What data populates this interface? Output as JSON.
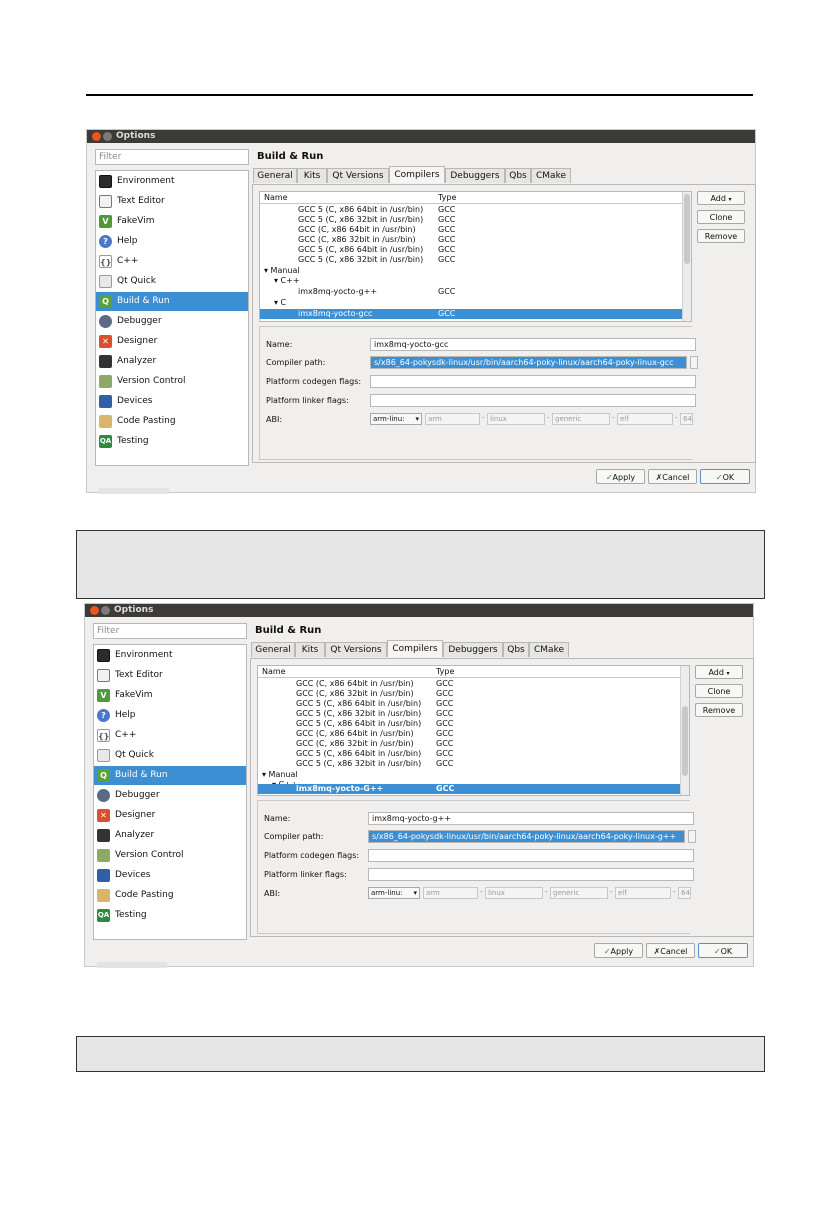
{
  "windows": [
    {
      "title": "Options",
      "filter_placeholder": "Filter",
      "heading": "Build & Run",
      "sidebar": [
        {
          "label": "Environment",
          "icon": "environment-icon"
        },
        {
          "label": "Text Editor",
          "icon": "text-editor-icon"
        },
        {
          "label": "FakeVim",
          "icon": "fakevim-icon"
        },
        {
          "label": "Help",
          "icon": "help-icon"
        },
        {
          "label": "C++",
          "icon": "cpp-icon"
        },
        {
          "label": "Qt Quick",
          "icon": "qt-quick-icon"
        },
        {
          "label": "Build & Run",
          "icon": "build-run-icon",
          "selected": true
        },
        {
          "label": "Debugger",
          "icon": "debugger-icon"
        },
        {
          "label": "Designer",
          "icon": "designer-icon"
        },
        {
          "label": "Analyzer",
          "icon": "analyzer-icon"
        },
        {
          "label": "Version Control",
          "icon": "version-control-icon"
        },
        {
          "label": "Devices",
          "icon": "devices-icon"
        },
        {
          "label": "Code Pasting",
          "icon": "code-pasting-icon"
        },
        {
          "label": "Testing",
          "icon": "testing-icon"
        }
      ],
      "tabs": [
        "General",
        "Kits",
        "Qt Versions",
        "Compilers",
        "Debuggers",
        "Qbs",
        "CMake"
      ],
      "active_tab": "Compilers",
      "table_headers": {
        "name": "Name",
        "type": "Type"
      },
      "rows": [
        {
          "name": "GCC 5 (C, x86 64bit in /usr/bin)",
          "type": "GCC",
          "indent": 3
        },
        {
          "name": "GCC 5 (C, x86 32bit in /usr/bin)",
          "type": "GCC",
          "indent": 3
        },
        {
          "name": "GCC (C, x86 64bit in /usr/bin)",
          "type": "GCC",
          "indent": 3
        },
        {
          "name": "GCC (C, x86 32bit in /usr/bin)",
          "type": "GCC",
          "indent": 3
        },
        {
          "name": "GCC 5 (C, x86 64bit in /usr/bin)",
          "type": "GCC",
          "indent": 3
        },
        {
          "name": "GCC 5 (C, x86 32bit in /usr/bin)",
          "type": "GCC",
          "indent": 3
        },
        {
          "name": "▾ Manual",
          "type": "",
          "indent": 0
        },
        {
          "name": "▾ C++",
          "type": "",
          "indent": 1
        },
        {
          "name": "imx8mq-yocto-g++",
          "type": "GCC",
          "indent": 3
        },
        {
          "name": "▾ C",
          "type": "",
          "indent": 1
        },
        {
          "name": "imx8mq-yocto-gcc",
          "type": "GCC",
          "indent": 3,
          "selected": true
        }
      ],
      "side_buttons": [
        "Add",
        "Clone",
        "Remove"
      ],
      "details": {
        "name_label": "Name:",
        "name_value": "imx8mq-yocto-gcc",
        "path_label": "Compiler path:",
        "path_value": "s/x86_64-pokysdk-linux/usr/bin/aarch64-poky-linux/aarch64-poky-linux-gcc",
        "codegen_label": "Platform codegen flags:",
        "linker_label": "Platform linker flags:",
        "abi_label": "ABI:",
        "abi_values": [
          "arm-linu:",
          "arm",
          "linux",
          "generic",
          "elf",
          "64"
        ]
      },
      "bottom_buttons": {
        "apply": "Apply",
        "cancel": "Cancel",
        "ok": "OK"
      }
    },
    {
      "title": "Options",
      "filter_placeholder": "Filter",
      "heading": "Build & Run",
      "sidebar": [
        {
          "label": "Environment",
          "icon": "environment-icon"
        },
        {
          "label": "Text Editor",
          "icon": "text-editor-icon"
        },
        {
          "label": "FakeVim",
          "icon": "fakevim-icon"
        },
        {
          "label": "Help",
          "icon": "help-icon"
        },
        {
          "label": "C++",
          "icon": "cpp-icon"
        },
        {
          "label": "Qt Quick",
          "icon": "qt-quick-icon"
        },
        {
          "label": "Build & Run",
          "icon": "build-run-icon",
          "selected": true
        },
        {
          "label": "Debugger",
          "icon": "debugger-icon"
        },
        {
          "label": "Designer",
          "icon": "designer-icon"
        },
        {
          "label": "Analyzer",
          "icon": "analyzer-icon"
        },
        {
          "label": "Version Control",
          "icon": "version-control-icon"
        },
        {
          "label": "Devices",
          "icon": "devices-icon"
        },
        {
          "label": "Code Pasting",
          "icon": "code-pasting-icon"
        },
        {
          "label": "Testing",
          "icon": "testing-icon"
        }
      ],
      "tabs": [
        "General",
        "Kits",
        "Qt Versions",
        "Compilers",
        "Debuggers",
        "Qbs",
        "CMake"
      ],
      "active_tab": "Compilers",
      "table_headers": {
        "name": "Name",
        "type": "Type"
      },
      "rows": [
        {
          "name": "GCC (C, x86 64bit in /usr/bin)",
          "type": "GCC",
          "indent": 3
        },
        {
          "name": "GCC (C, x86 32bit in /usr/bin)",
          "type": "GCC",
          "indent": 3
        },
        {
          "name": "GCC 5 (C, x86 64bit in /usr/bin)",
          "type": "GCC",
          "indent": 3
        },
        {
          "name": "GCC 5 (C, x86 32bit in /usr/bin)",
          "type": "GCC",
          "indent": 3
        },
        {
          "name": "GCC 5 (C, x86 64bit in /usr/bin)",
          "type": "GCC",
          "indent": 3
        },
        {
          "name": "GCC (C, x86 64bit in /usr/bin)",
          "type": "GCC",
          "indent": 3
        },
        {
          "name": "GCC (C, x86 32bit in /usr/bin)",
          "type": "GCC",
          "indent": 3
        },
        {
          "name": "GCC 5 (C, x86 64bit in /usr/bin)",
          "type": "GCC",
          "indent": 3
        },
        {
          "name": "GCC 5 (C, x86 32bit in /usr/bin)",
          "type": "GCC",
          "indent": 3
        },
        {
          "name": "▾ Manual",
          "type": "",
          "indent": 0
        },
        {
          "name": "▾ C++",
          "type": "",
          "indent": 1
        },
        {
          "name": "imx8mq-yocto-G++",
          "type": "GCC",
          "indent": 3,
          "selected": true
        }
      ],
      "side_buttons": [
        "Add",
        "Clone",
        "Remove"
      ],
      "details": {
        "name_label": "Name:",
        "name_value": "imx8mq-yocto-g++",
        "path_label": "Compiler path:",
        "path_value": "s/x86_64-pokysdk-linux/usr/bin/aarch64-poky-linux/aarch64-poky-linux-g++",
        "codegen_label": "Platform codegen flags:",
        "linker_label": "Platform linker flags:",
        "abi_label": "ABI:",
        "abi_values": [
          "arm-linu:",
          "arm",
          "linux",
          "generic",
          "elf",
          "64"
        ]
      },
      "bottom_buttons": {
        "apply": "Apply",
        "cancel": "Cancel",
        "ok": "OK"
      }
    }
  ]
}
